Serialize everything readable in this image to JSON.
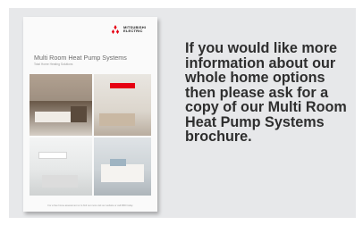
{
  "brochure": {
    "brand_name": "MITSUBISHI ELECTRIC",
    "title": "Multi Room Heat Pump Systems",
    "subtitle": "Total Home Heating Solutions",
    "footer_text": "For a free home assessment or to find out more visit our website or call 0800 today"
  },
  "message": {
    "text": "If you would like more information about our whole home options then please ask for a copy of our Multi Room Heat Pump Systems brochure."
  },
  "colors": {
    "panel_bg": "#e7e8ea",
    "brand_red": "#e60012",
    "text_dark": "#2e2e2e"
  }
}
